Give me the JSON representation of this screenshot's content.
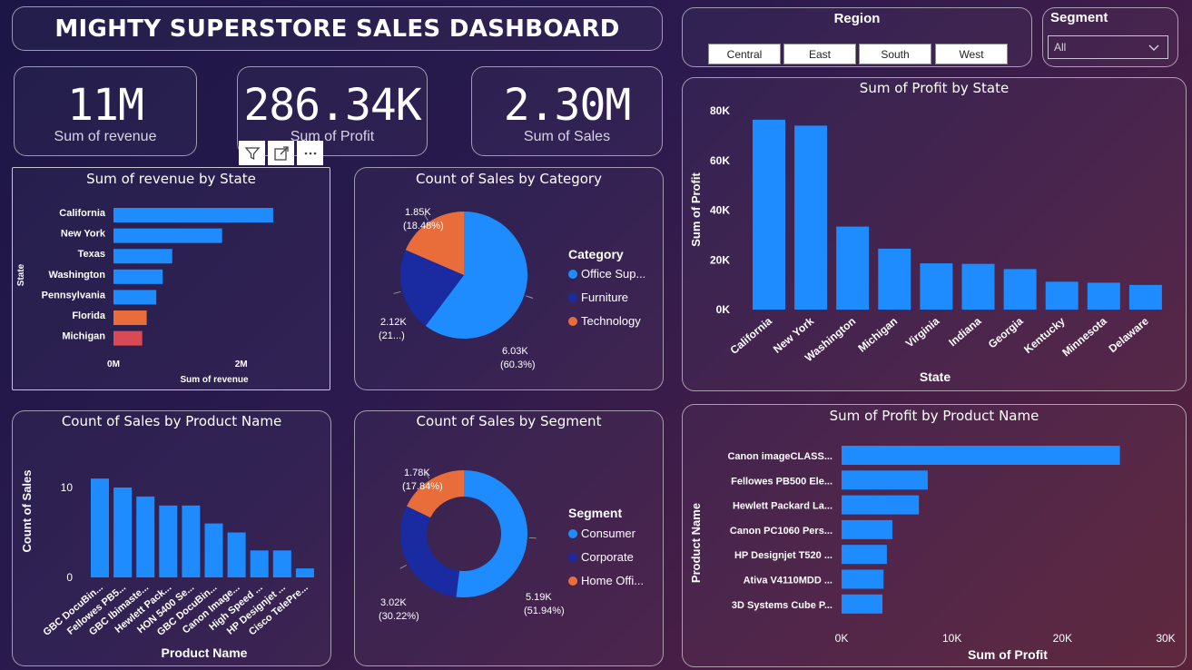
{
  "title": "MIGHTY SUPERSTORE SALES DASHBOARD",
  "kpis": [
    {
      "value": "11M",
      "label": "Sum of revenue"
    },
    {
      "value": "286.34K",
      "label": "Sum of Profit"
    },
    {
      "value": "2.30M",
      "label": "Sum of Sales"
    }
  ],
  "region_slicer": {
    "title": "Region",
    "options": [
      "Central",
      "East",
      "South",
      "West"
    ]
  },
  "segment_slicer": {
    "title": "Segment",
    "selected": "All"
  },
  "colors": {
    "blue": "#1e8cff",
    "navy": "#1a2aa0",
    "orange": "#e86d3a",
    "red": "#d94a55"
  },
  "chart_data": [
    {
      "id": "revenue_by_state",
      "type": "bar",
      "orientation": "horizontal",
      "title": "Sum of revenue by State",
      "xlabel": "Sum of revenue",
      "ylabel": "State",
      "categories": [
        "California",
        "New York",
        "Texas",
        "Washington",
        "Pennsylvania",
        "Florida",
        "Michigan"
      ],
      "values": [
        2500000,
        1700000,
        920000,
        770000,
        670000,
        520000,
        450000
      ],
      "bar_colors": [
        "#1e8cff",
        "#1e8cff",
        "#1e8cff",
        "#1e8cff",
        "#1e8cff",
        "#e86d3a",
        "#d94a55"
      ],
      "xticks": [
        "0M",
        "2M"
      ],
      "xlim": [
        0,
        2800000
      ]
    },
    {
      "id": "sales_by_category",
      "type": "pie",
      "title": "Count of Sales by Category",
      "legend_title": "Category",
      "slices": [
        {
          "label": "Office Sup...",
          "value": 6030,
          "value_label": "6.03K",
          "pct_label": "(60.3%)",
          "color": "#1e8cff"
        },
        {
          "label": "Furniture",
          "value": 2120,
          "value_label": "2.12K",
          "pct_label": "(21...)",
          "color": "#1a2aa0"
        },
        {
          "label": "Technology",
          "value": 1850,
          "value_label": "1.85K",
          "pct_label": "(18.48%)",
          "color": "#e86d3a"
        }
      ]
    },
    {
      "id": "profit_by_state",
      "type": "bar",
      "title": "Sum of Profit by State",
      "xlabel": "State",
      "ylabel": "Sum of Profit",
      "categories": [
        "California",
        "New York",
        "Washington",
        "Michigan",
        "Virginia",
        "Indiana",
        "Georgia",
        "Kentucky",
        "Minnesota",
        "Delaware"
      ],
      "values": [
        76400,
        74000,
        33400,
        24500,
        18600,
        18400,
        16300,
        11200,
        10800,
        9900
      ],
      "yticks": [
        "0K",
        "20K",
        "40K",
        "60K",
        "80K"
      ],
      "ylim": [
        0,
        80000
      ]
    },
    {
      "id": "sales_by_product",
      "type": "bar",
      "title": "Count of Sales by Product Name",
      "xlabel": "Product Name",
      "ylabel": "Count of Sales",
      "categories": [
        "GBC DocuBin...",
        "Fellowes PB5...",
        "GBC Ibimaste...",
        "Hewlett Pack...",
        "HON 5400 Se...",
        "GBC DocuBin...",
        "Canon Image...",
        "High Speed ...",
        "HP Designjet ...",
        "Cisco TelePre..."
      ],
      "values": [
        11,
        10,
        9,
        8,
        8,
        6,
        5,
        3,
        3,
        1
      ],
      "yticks": [
        "0",
        "10"
      ],
      "ylim": [
        0,
        12
      ]
    },
    {
      "id": "sales_by_segment",
      "type": "pie",
      "donut": true,
      "title": "Count of Sales by Segment",
      "legend_title": "Segment",
      "slices": [
        {
          "label": "Consumer",
          "value": 5190,
          "value_label": "5.19K",
          "pct_label": "(51.94%)",
          "color": "#1e8cff"
        },
        {
          "label": "Corporate",
          "value": 3020,
          "value_label": "3.02K",
          "pct_label": "(30.22%)",
          "color": "#1a2aa0"
        },
        {
          "label": "Home Offi...",
          "value": 1780,
          "value_label": "1.78K",
          "pct_label": "(17.84%)",
          "color": "#e86d3a"
        }
      ]
    },
    {
      "id": "profit_by_product",
      "type": "bar",
      "orientation": "horizontal",
      "title": "Sum of Profit by Product Name",
      "xlabel": "Sum of Profit",
      "ylabel": "Product Name",
      "categories": [
        "Canon imageCLASS...",
        "Fellowes PB500 Ele...",
        "Hewlett Packard La...",
        "Canon PC1060 Pers...",
        "HP Designjet T520 ...",
        "Ativa V4110MDD ...",
        "3D Systems Cube P..."
      ],
      "values": [
        25200,
        7800,
        7000,
        4600,
        4100,
        3800,
        3700
      ],
      "xticks": [
        "0K",
        "10K",
        "20K",
        "30K"
      ],
      "xlim": [
        0,
        30000
      ]
    }
  ]
}
